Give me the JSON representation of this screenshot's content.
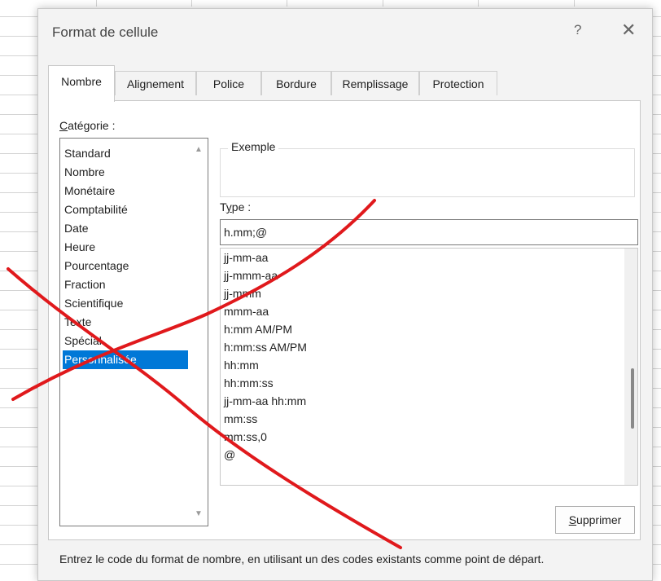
{
  "dialog": {
    "title": "Format de cellule",
    "help": "?",
    "close": "✕"
  },
  "tabs": [
    "Nombre",
    "Alignement",
    "Police",
    "Bordure",
    "Remplissage",
    "Protection"
  ],
  "active_tab": "Nombre",
  "category": {
    "label_u": "C",
    "label_rest": "atégorie :",
    "items": [
      "Standard",
      "Nombre",
      "Monétaire",
      "Comptabilité",
      "Date",
      "Heure",
      "Pourcentage",
      "Fraction",
      "Scientifique",
      "Texte",
      "Spécial",
      "Personnalisée"
    ],
    "selected": "Personnalisée"
  },
  "example": {
    "label": "Exemple"
  },
  "type": {
    "label_pre": "T",
    "label_u": "y",
    "label_post": "pe :",
    "value": "h.mm;@"
  },
  "formats": [
    "jj-mm-aa",
    "jj-mmm-aa",
    "jj-mmm",
    "mmm-aa",
    "h:mm AM/PM",
    "h:mm:ss AM/PM",
    "hh:mm",
    "hh:mm:ss",
    "jj-mm-aa hh:mm",
    "mm:ss",
    "mm:ss,0",
    "@"
  ],
  "buttons": {
    "delete_u": "S",
    "delete_rest": "upprimer"
  },
  "hint": "Entrez le code du format de nombre, en utilisant un des codes existants comme point de départ.",
  "colors": {
    "accent": "#0078d7",
    "annotation": "#e0191c"
  }
}
